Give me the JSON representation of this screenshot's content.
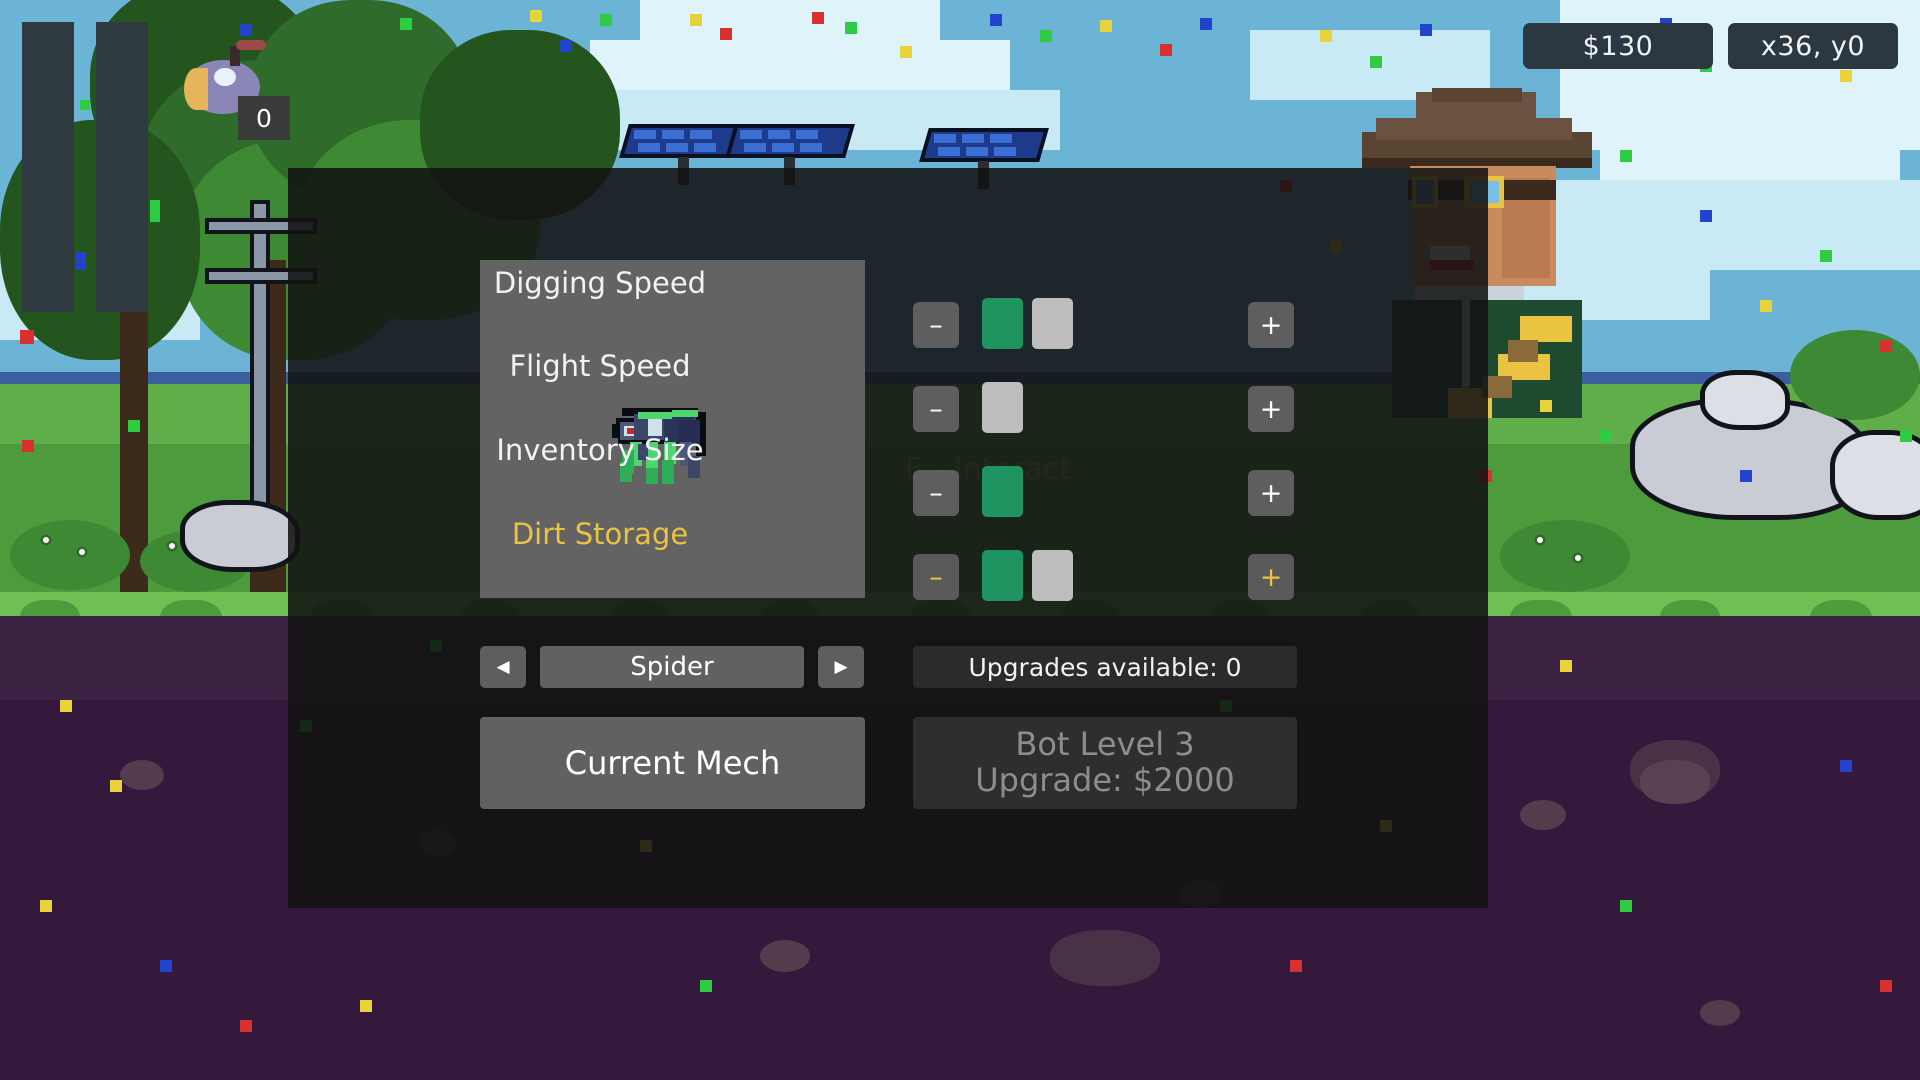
{
  "hud": {
    "money": "$130",
    "coordinates": "x36,  y0",
    "bomb_count": "0",
    "interact_hint": "E - Interact"
  },
  "modal": {
    "preview": {
      "mech_sprite": "spider-mech-sprite"
    },
    "upgrades": [
      {
        "label": "Digging Speed",
        "selected": false,
        "decrement_label": "–",
        "increment_label": "+",
        "pips": [
          "filled",
          "avail"
        ]
      },
      {
        "label": "Flight Speed",
        "selected": false,
        "decrement_label": "–",
        "increment_label": "+",
        "pips": [
          "avail"
        ]
      },
      {
        "label": "Inventory Size",
        "selected": false,
        "decrement_label": "–",
        "increment_label": "+",
        "pips": [
          "filled"
        ]
      },
      {
        "label": "Dirt Storage",
        "selected": true,
        "decrement_label": "–",
        "increment_label": "+",
        "pips": [
          "filled",
          "avail"
        ]
      }
    ],
    "selector": {
      "prev_label": "◀",
      "next_label": "▶",
      "mech_name": "Spider"
    },
    "upgrades_available": "Upgrades available: 0",
    "current_mech_label": "Current Mech",
    "bot_upgrade": {
      "line1": "Bot Level 3",
      "line2": "Upgrade: $2000"
    }
  },
  "colors": {
    "accent_gold": "#E9C341",
    "pip_filled": "#1F9460",
    "pip_available": "#BDBDBD",
    "hud_box": "#2C3841",
    "panel": "#121212"
  }
}
